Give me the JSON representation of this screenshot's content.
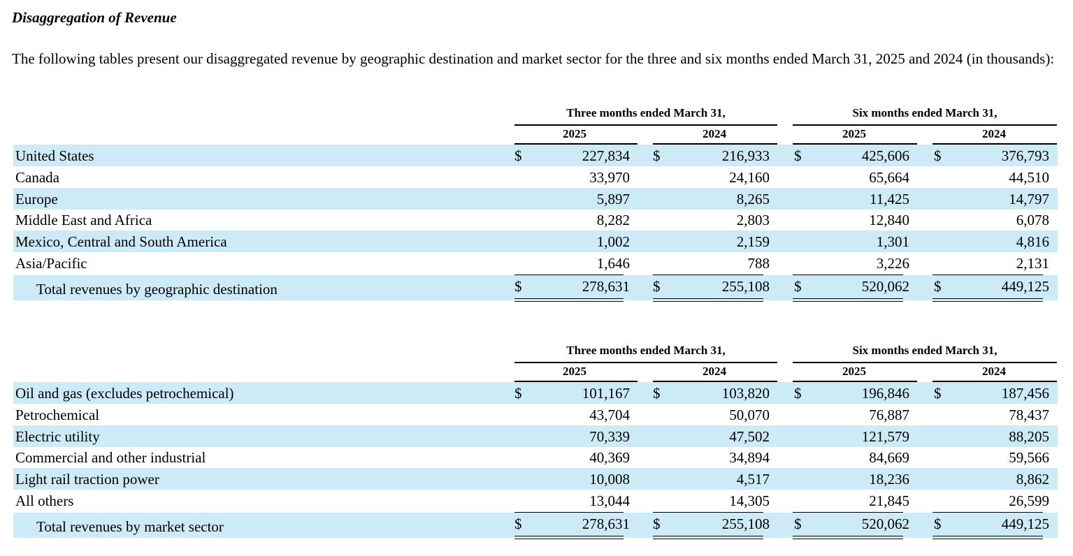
{
  "title": "Disaggregation of Revenue",
  "intro": "The following tables present our disaggregated revenue by geographic destination and market sector for the three and six months ended March 31, 2025 and 2024 (in thousands):",
  "tables": [
    {
      "period_headers": [
        "Three months ended March 31,",
        "Six months ended March 31,"
      ],
      "year_headers": [
        "2025",
        "2024",
        "2025",
        "2024"
      ],
      "currency_symbol": "$",
      "rows": [
        {
          "label": "United States",
          "values": [
            "227,834",
            "216,933",
            "425,606",
            "376,793"
          ]
        },
        {
          "label": "Canada",
          "values": [
            "33,970",
            "24,160",
            "65,664",
            "44,510"
          ]
        },
        {
          "label": "Europe",
          "values": [
            "5,897",
            "8,265",
            "11,425",
            "14,797"
          ]
        },
        {
          "label": "Middle East and Africa",
          "values": [
            "8,282",
            "2,803",
            "12,840",
            "6,078"
          ]
        },
        {
          "label": "Mexico, Central and South America",
          "values": [
            "1,002",
            "2,159",
            "1,301",
            "4,816"
          ]
        },
        {
          "label": "Asia/Pacific",
          "values": [
            "1,646",
            "788",
            "3,226",
            "2,131"
          ]
        }
      ],
      "total": {
        "label": "Total revenues by geographic destination",
        "values": [
          "278,631",
          "255,108",
          "520,062",
          "449,125"
        ]
      }
    },
    {
      "period_headers": [
        "Three months ended March 31,",
        "Six months ended March 31,"
      ],
      "year_headers": [
        "2025",
        "2024",
        "2025",
        "2024"
      ],
      "currency_symbol": "$",
      "rows": [
        {
          "label": "Oil and gas (excludes petrochemical)",
          "values": [
            "101,167",
            "103,820",
            "196,846",
            "187,456"
          ]
        },
        {
          "label": "Petrochemical",
          "values": [
            "43,704",
            "50,070",
            "76,887",
            "78,437"
          ]
        },
        {
          "label": "Electric utility",
          "values": [
            "70,339",
            "47,502",
            "121,579",
            "88,205"
          ]
        },
        {
          "label": "Commercial and other industrial",
          "values": [
            "40,369",
            "34,894",
            "84,669",
            "59,566"
          ]
        },
        {
          "label": "Light rail traction power",
          "values": [
            "10,008",
            "4,517",
            "18,236",
            "8,862"
          ]
        },
        {
          "label": "All others",
          "values": [
            "13,044",
            "14,305",
            "21,845",
            "26,599"
          ]
        }
      ],
      "total": {
        "label": "Total revenues by market sector",
        "values": [
          "278,631",
          "255,108",
          "520,062",
          "449,125"
        ]
      }
    }
  ]
}
